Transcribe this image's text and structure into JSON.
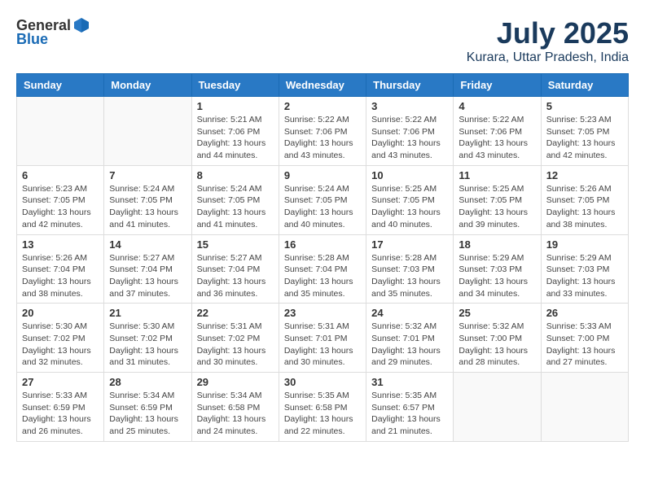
{
  "header": {
    "logo_general": "General",
    "logo_blue": "Blue",
    "month": "July 2025",
    "location": "Kurara, Uttar Pradesh, India"
  },
  "days_of_week": [
    "Sunday",
    "Monday",
    "Tuesday",
    "Wednesday",
    "Thursday",
    "Friday",
    "Saturday"
  ],
  "weeks": [
    [
      {
        "day": "",
        "info": ""
      },
      {
        "day": "",
        "info": ""
      },
      {
        "day": "1",
        "info": "Sunrise: 5:21 AM\nSunset: 7:06 PM\nDaylight: 13 hours and 44 minutes."
      },
      {
        "day": "2",
        "info": "Sunrise: 5:22 AM\nSunset: 7:06 PM\nDaylight: 13 hours and 43 minutes."
      },
      {
        "day": "3",
        "info": "Sunrise: 5:22 AM\nSunset: 7:06 PM\nDaylight: 13 hours and 43 minutes."
      },
      {
        "day": "4",
        "info": "Sunrise: 5:22 AM\nSunset: 7:06 PM\nDaylight: 13 hours and 43 minutes."
      },
      {
        "day": "5",
        "info": "Sunrise: 5:23 AM\nSunset: 7:05 PM\nDaylight: 13 hours and 42 minutes."
      }
    ],
    [
      {
        "day": "6",
        "info": "Sunrise: 5:23 AM\nSunset: 7:05 PM\nDaylight: 13 hours and 42 minutes."
      },
      {
        "day": "7",
        "info": "Sunrise: 5:24 AM\nSunset: 7:05 PM\nDaylight: 13 hours and 41 minutes."
      },
      {
        "day": "8",
        "info": "Sunrise: 5:24 AM\nSunset: 7:05 PM\nDaylight: 13 hours and 41 minutes."
      },
      {
        "day": "9",
        "info": "Sunrise: 5:24 AM\nSunset: 7:05 PM\nDaylight: 13 hours and 40 minutes."
      },
      {
        "day": "10",
        "info": "Sunrise: 5:25 AM\nSunset: 7:05 PM\nDaylight: 13 hours and 40 minutes."
      },
      {
        "day": "11",
        "info": "Sunrise: 5:25 AM\nSunset: 7:05 PM\nDaylight: 13 hours and 39 minutes."
      },
      {
        "day": "12",
        "info": "Sunrise: 5:26 AM\nSunset: 7:05 PM\nDaylight: 13 hours and 38 minutes."
      }
    ],
    [
      {
        "day": "13",
        "info": "Sunrise: 5:26 AM\nSunset: 7:04 PM\nDaylight: 13 hours and 38 minutes."
      },
      {
        "day": "14",
        "info": "Sunrise: 5:27 AM\nSunset: 7:04 PM\nDaylight: 13 hours and 37 minutes."
      },
      {
        "day": "15",
        "info": "Sunrise: 5:27 AM\nSunset: 7:04 PM\nDaylight: 13 hours and 36 minutes."
      },
      {
        "day": "16",
        "info": "Sunrise: 5:28 AM\nSunset: 7:04 PM\nDaylight: 13 hours and 35 minutes."
      },
      {
        "day": "17",
        "info": "Sunrise: 5:28 AM\nSunset: 7:03 PM\nDaylight: 13 hours and 35 minutes."
      },
      {
        "day": "18",
        "info": "Sunrise: 5:29 AM\nSunset: 7:03 PM\nDaylight: 13 hours and 34 minutes."
      },
      {
        "day": "19",
        "info": "Sunrise: 5:29 AM\nSunset: 7:03 PM\nDaylight: 13 hours and 33 minutes."
      }
    ],
    [
      {
        "day": "20",
        "info": "Sunrise: 5:30 AM\nSunset: 7:02 PM\nDaylight: 13 hours and 32 minutes."
      },
      {
        "day": "21",
        "info": "Sunrise: 5:30 AM\nSunset: 7:02 PM\nDaylight: 13 hours and 31 minutes."
      },
      {
        "day": "22",
        "info": "Sunrise: 5:31 AM\nSunset: 7:02 PM\nDaylight: 13 hours and 30 minutes."
      },
      {
        "day": "23",
        "info": "Sunrise: 5:31 AM\nSunset: 7:01 PM\nDaylight: 13 hours and 30 minutes."
      },
      {
        "day": "24",
        "info": "Sunrise: 5:32 AM\nSunset: 7:01 PM\nDaylight: 13 hours and 29 minutes."
      },
      {
        "day": "25",
        "info": "Sunrise: 5:32 AM\nSunset: 7:00 PM\nDaylight: 13 hours and 28 minutes."
      },
      {
        "day": "26",
        "info": "Sunrise: 5:33 AM\nSunset: 7:00 PM\nDaylight: 13 hours and 27 minutes."
      }
    ],
    [
      {
        "day": "27",
        "info": "Sunrise: 5:33 AM\nSunset: 6:59 PM\nDaylight: 13 hours and 26 minutes."
      },
      {
        "day": "28",
        "info": "Sunrise: 5:34 AM\nSunset: 6:59 PM\nDaylight: 13 hours and 25 minutes."
      },
      {
        "day": "29",
        "info": "Sunrise: 5:34 AM\nSunset: 6:58 PM\nDaylight: 13 hours and 24 minutes."
      },
      {
        "day": "30",
        "info": "Sunrise: 5:35 AM\nSunset: 6:58 PM\nDaylight: 13 hours and 22 minutes."
      },
      {
        "day": "31",
        "info": "Sunrise: 5:35 AM\nSunset: 6:57 PM\nDaylight: 13 hours and 21 minutes."
      },
      {
        "day": "",
        "info": ""
      },
      {
        "day": "",
        "info": ""
      }
    ]
  ]
}
